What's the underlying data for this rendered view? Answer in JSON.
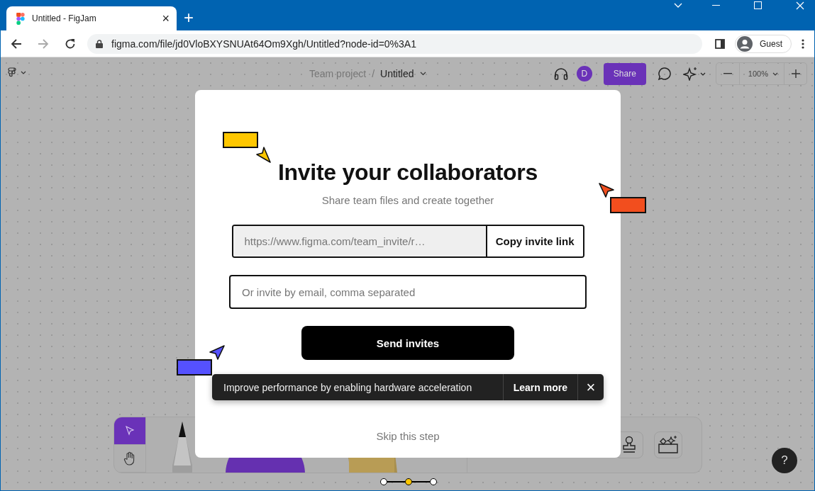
{
  "browser": {
    "tab": {
      "title": "Untitled - FigJam",
      "close": "×"
    },
    "new_tab": "+",
    "url": "figma.com/file/jd0VloBXYSNUAt64Om9Xgh/Untitled?node-id=0%3A1",
    "profile": "Guest"
  },
  "toolbar": {
    "project": "Team project",
    "separator": "/",
    "file": "Untitled",
    "avatar": "D",
    "share": "Share",
    "zoom": "100%"
  },
  "dialog": {
    "title": "Invite your collaborators",
    "subtitle": "Share team files and create together",
    "invite_link": {
      "value": "https://www.figma.com/team_invite/r…",
      "button": "Copy invite link"
    },
    "email": {
      "placeholder": "Or invite by email, comma separated"
    },
    "send": "Send invites",
    "skip": "Skip this step",
    "steps": [
      {
        "selected": false
      },
      {
        "selected": true
      },
      {
        "selected": false
      }
    ]
  },
  "toast": {
    "message": "Improve performance by enabling hardware acceleration",
    "action": "Learn more",
    "close": "×"
  },
  "tools": [
    {
      "kind": "select",
      "selected": true
    },
    {
      "kind": "hand",
      "selected": false
    }
  ],
  "help": "?"
}
